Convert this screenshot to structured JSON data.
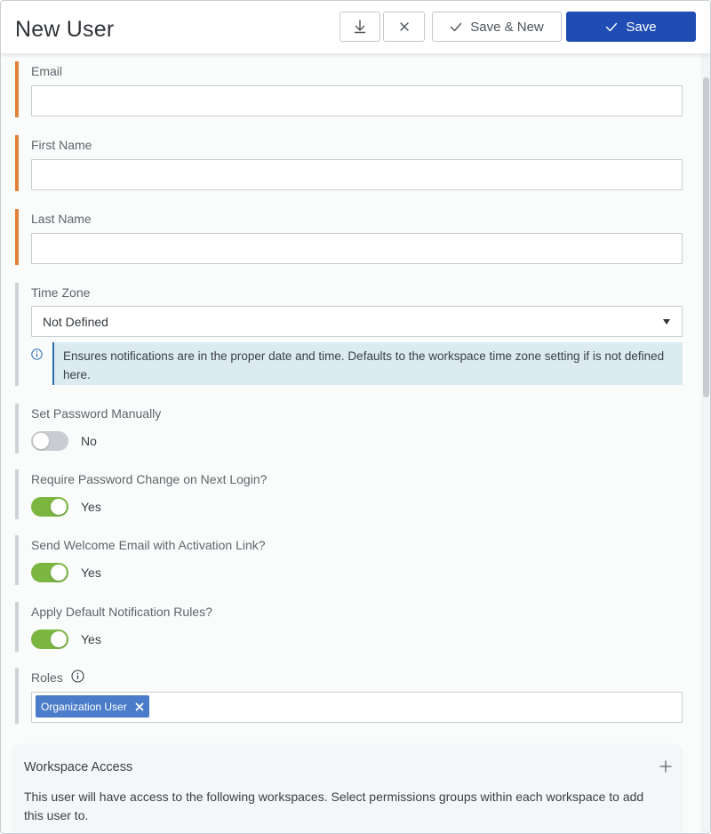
{
  "header": {
    "title": "New User",
    "save_new_label": "Save & New",
    "save_label": "Save"
  },
  "form": {
    "email": {
      "label": "Email",
      "value": ""
    },
    "first_name": {
      "label": "First Name",
      "value": ""
    },
    "last_name": {
      "label": "Last Name",
      "value": ""
    },
    "time_zone": {
      "label": "Time Zone",
      "value": "Not Defined",
      "help": "Ensures notifications are in the proper date and time. Defaults to the workspace time zone setting if is not defined here."
    },
    "set_password": {
      "label": "Set Password Manually",
      "state": "No",
      "on": false
    },
    "require_change": {
      "label": "Require Password Change on Next Login?",
      "state": "Yes",
      "on": true
    },
    "welcome_email": {
      "label": "Send Welcome Email with Activation Link?",
      "state": "Yes",
      "on": true
    },
    "notification_rules": {
      "label": "Apply Default Notification Rules?",
      "state": "Yes",
      "on": true
    },
    "roles": {
      "label": "Roles",
      "selected": [
        "Organization User"
      ]
    }
  },
  "workspace_access": {
    "title": "Workspace Access",
    "description": "This user will have access to the following workspaces. Select permissions groups within each workspace to add this user to."
  },
  "colors": {
    "primary": "#1f4db3",
    "required_marker": "#e0823a",
    "toggle_on": "#7ab640",
    "chip": "#4b7cc9",
    "info_background": "#dcebf2"
  },
  "icons": {
    "collapse": "arrow-down-to-line-icon",
    "close": "close-icon",
    "check": "check-icon",
    "info": "info-circle-icon",
    "remove": "remove-x-icon",
    "add": "plus-icon"
  }
}
